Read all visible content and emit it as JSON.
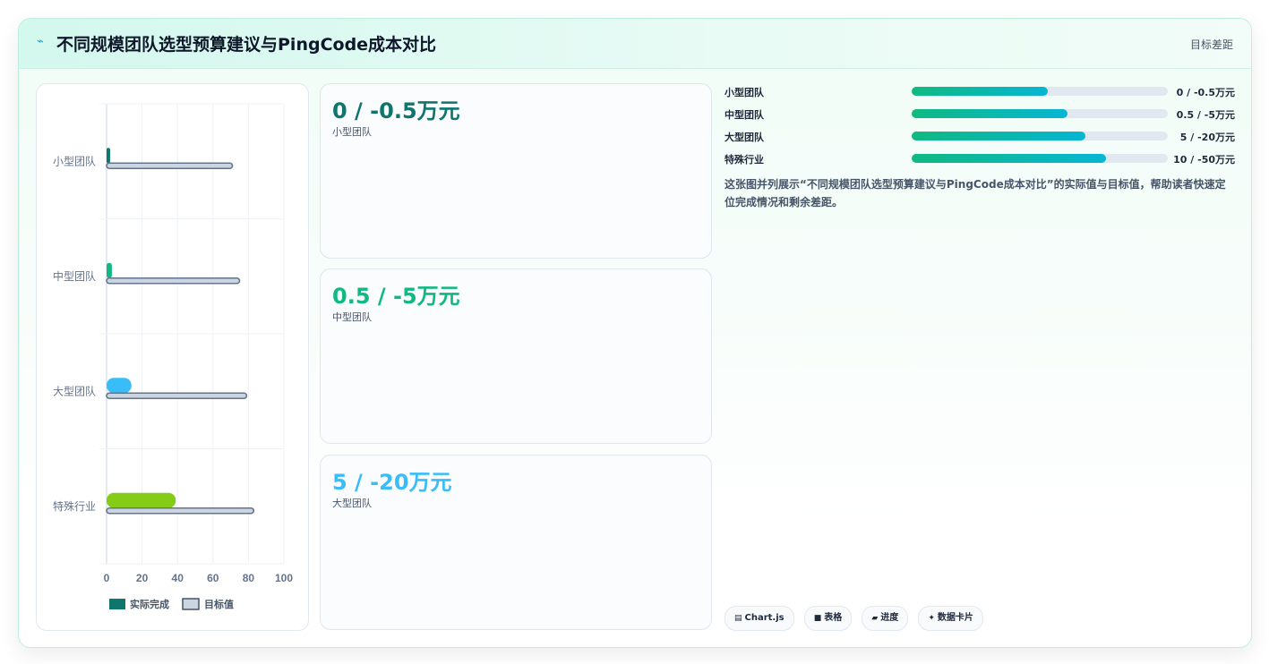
{
  "header": {
    "icon": "bolt-icon",
    "title": "不同规模团队选型预算建议与PingCode成本对比",
    "right_label": "目标差距"
  },
  "kpis": [
    {
      "value": "0 / -0.5万元",
      "label": "小型团队",
      "color": "#0f766e"
    },
    {
      "value": "0.5 / -5万元",
      "label": "中型团队",
      "color": "#10b981"
    },
    {
      "value": "5 / -20万元",
      "label": "大型团队",
      "color": "#38bdf8"
    }
  ],
  "progress": [
    {
      "name": "小型团队",
      "value": "0 / -0.5万元",
      "fraction": 0.53
    },
    {
      "name": "中型团队",
      "value": "0.5 / -5万元",
      "fraction": 0.61
    },
    {
      "name": "大型团队",
      "value": "5 / -20万元",
      "fraction": 0.68
    },
    {
      "name": "特殊行业",
      "value": "10 / -50万元",
      "fraction": 0.76
    }
  ],
  "description": "这张图并列展示“不同规模团队选型预算建议与PingCode成本对比”的实际值与目标值，帮助读者快速定位完成情况和剩余差距。",
  "tags": [
    {
      "icon": "chart-icon",
      "glyph": "▤",
      "label": "Chart.js"
    },
    {
      "icon": "table-icon",
      "glyph": "■",
      "label": "表格"
    },
    {
      "icon": "progress-icon",
      "glyph": "▰",
      "label": "进度"
    },
    {
      "icon": "sparkle-icon",
      "glyph": "✦",
      "label": "数据卡片"
    }
  ],
  "chart_data": {
    "type": "bar",
    "orientation": "horizontal",
    "categories": [
      "小型团队",
      "中型团队",
      "大型团队",
      "特殊行业"
    ],
    "series": [
      {
        "name": "实际完成",
        "values": [
          2,
          3,
          14,
          39
        ],
        "colors": [
          "#0f766e",
          "#10b981",
          "#38bdf8",
          "#84cc16"
        ]
      },
      {
        "name": "目标值",
        "values": [
          71,
          75,
          79,
          83
        ],
        "color": "#cbd5e1",
        "border": "#64748b"
      }
    ],
    "xlim": [
      0,
      100
    ],
    "xticks": [
      "0",
      "20",
      "40",
      "60",
      "80",
      "100"
    ],
    "grid": true,
    "legend": "bottom"
  }
}
